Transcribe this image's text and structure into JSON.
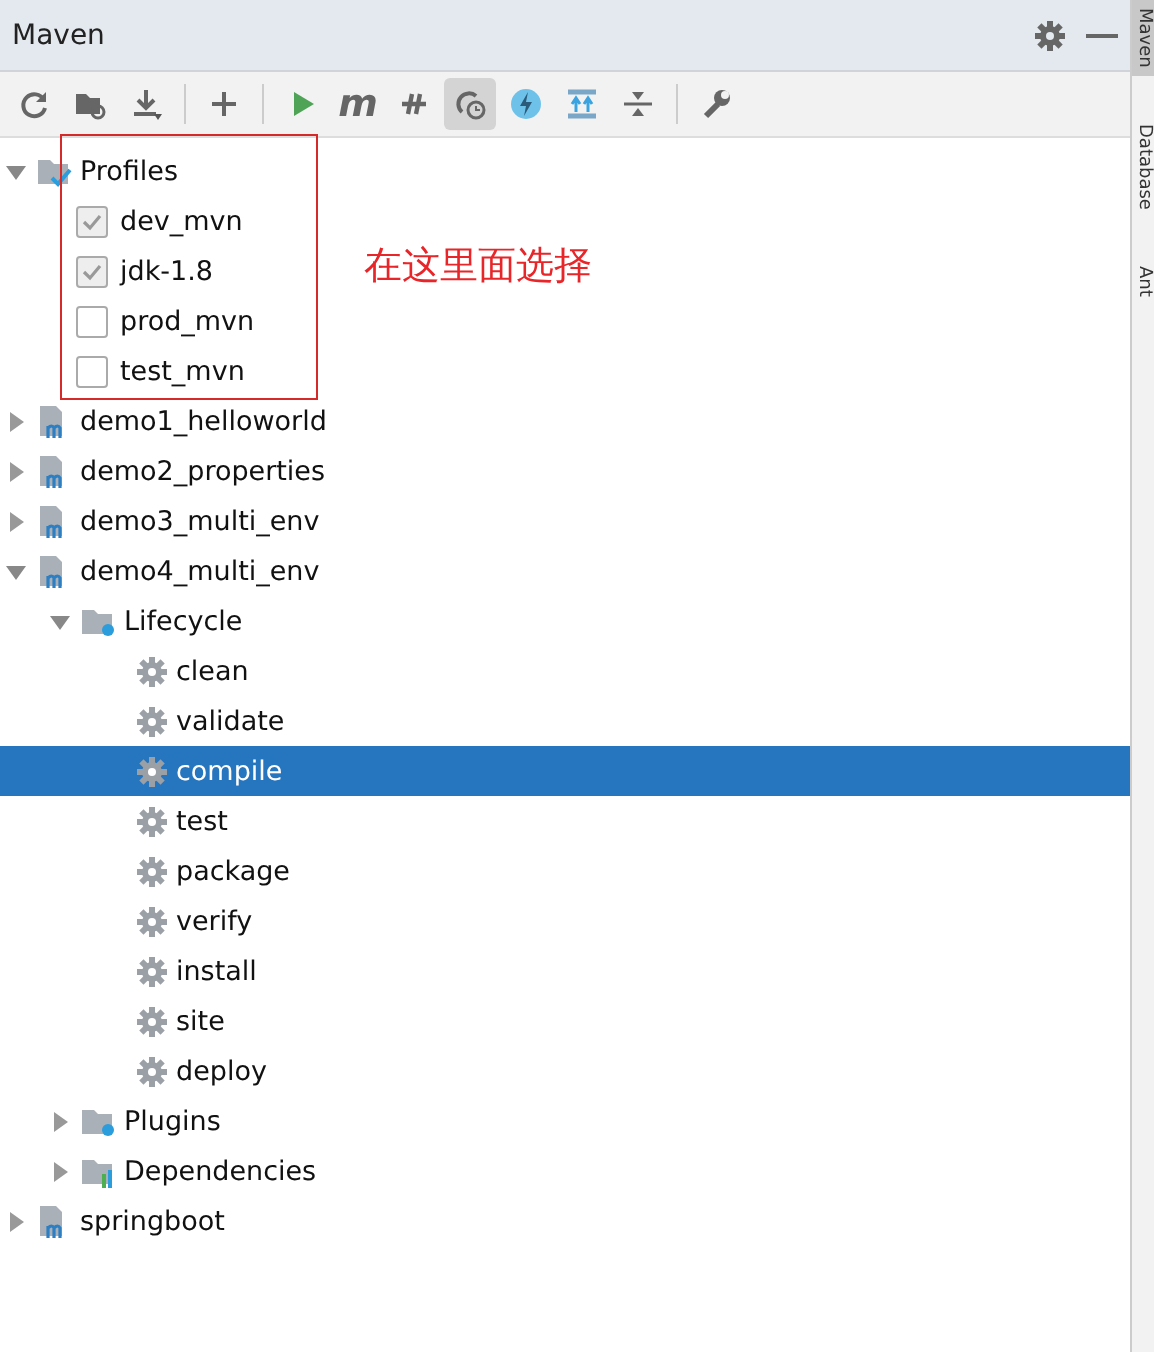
{
  "panel": {
    "title": "Maven"
  },
  "toolbar": [
    {
      "pressed": false
    },
    {
      "pressed": false
    },
    {
      "pressed": false
    },
    {
      "pressed": false
    },
    {
      "pressed": false
    },
    {
      "label": "m",
      "pressed": false
    },
    {
      "pressed": false
    },
    {
      "pressed": true
    },
    {
      "pressed": false
    },
    {
      "pressed": false
    },
    {
      "pressed": false
    },
    {
      "pressed": false
    }
  ],
  "tree": [
    {
      "kind": "profiles",
      "label": "Profiles",
      "expanded": true,
      "children": [
        {
          "kind": "profile",
          "label": "dev_mvn",
          "checked": true
        },
        {
          "kind": "profile",
          "label": "jdk-1.8",
          "checked": true
        },
        {
          "kind": "profile",
          "label": "prod_mvn",
          "checked": false
        },
        {
          "kind": "profile",
          "label": "test_mvn",
          "checked": false
        }
      ]
    },
    {
      "kind": "module",
      "label": "demo1_helloworld",
      "expanded": false
    },
    {
      "kind": "module",
      "label": "demo2_properties",
      "expanded": false
    },
    {
      "kind": "module",
      "label": "demo3_multi_env",
      "expanded": false
    },
    {
      "kind": "module",
      "label": "demo4_multi_env",
      "expanded": true,
      "children": [
        {
          "kind": "lifecycle",
          "label": "Lifecycle",
          "expanded": true,
          "children": [
            {
              "kind": "goal",
              "label": "clean",
              "selected": false
            },
            {
              "kind": "goal",
              "label": "validate",
              "selected": false
            },
            {
              "kind": "goal",
              "label": "compile",
              "selected": true
            },
            {
              "kind": "goal",
              "label": "test",
              "selected": false
            },
            {
              "kind": "goal",
              "label": "package",
              "selected": false
            },
            {
              "kind": "goal",
              "label": "verify",
              "selected": false
            },
            {
              "kind": "goal",
              "label": "install",
              "selected": false
            },
            {
              "kind": "goal",
              "label": "site",
              "selected": false
            },
            {
              "kind": "goal",
              "label": "deploy",
              "selected": false
            }
          ]
        },
        {
          "kind": "plugins",
          "label": "Plugins",
          "expanded": false
        },
        {
          "kind": "dependencies",
          "label": "Dependencies",
          "expanded": false
        }
      ]
    },
    {
      "kind": "module",
      "label": "springboot",
      "expanded": false
    }
  ],
  "annotation": "在这里面选择",
  "side_tabs": [
    {
      "label": "Maven",
      "selected": true
    },
    {
      "label": "Database",
      "selected": false
    },
    {
      "label": "Ant",
      "selected": false
    }
  ]
}
